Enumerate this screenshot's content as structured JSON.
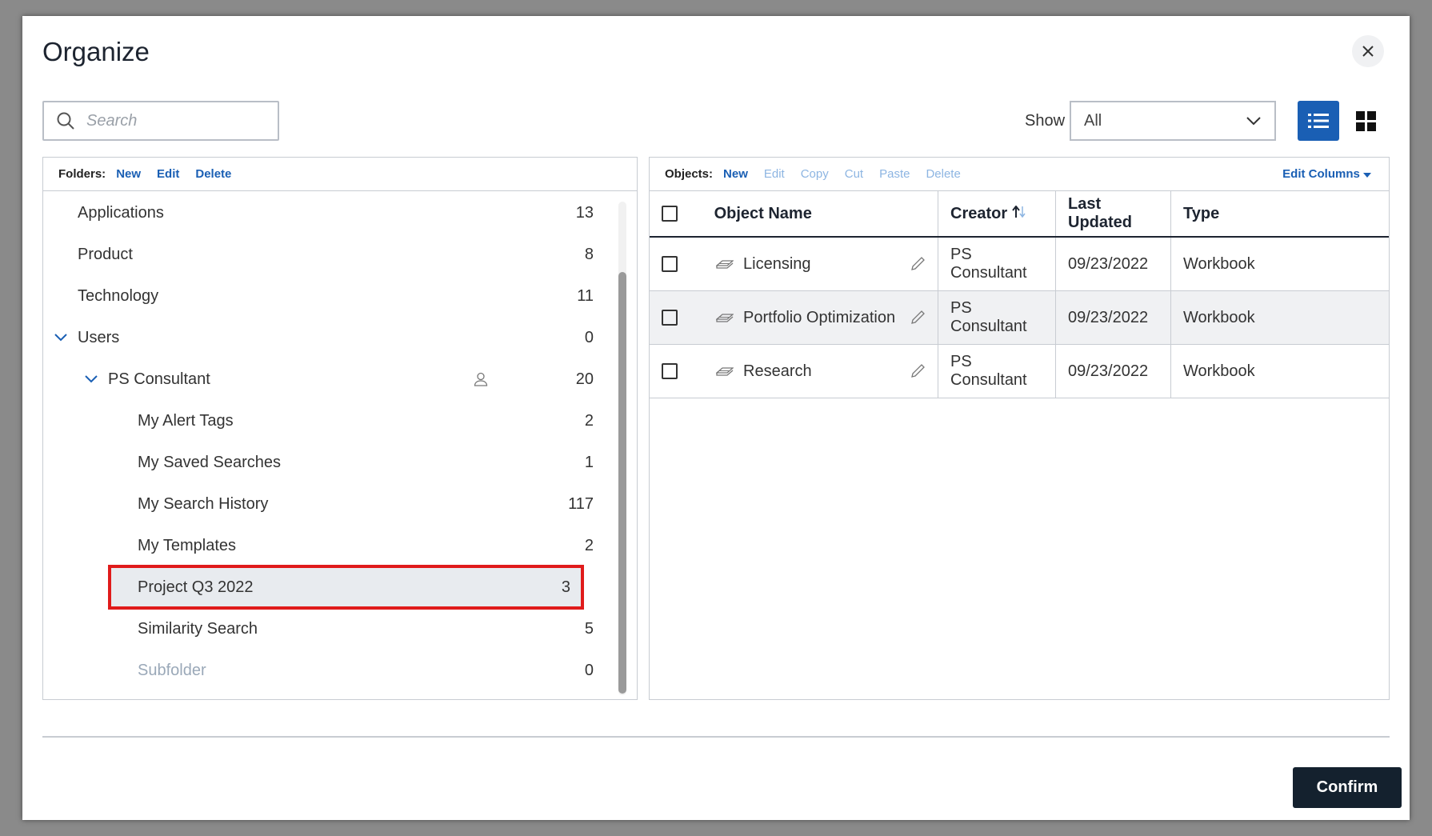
{
  "dialog": {
    "title": "Organize"
  },
  "search": {
    "placeholder": "Search"
  },
  "show": {
    "label": "Show",
    "selected": "All"
  },
  "folders_toolbar": {
    "label": "Folders:",
    "new": "New",
    "edit": "Edit",
    "delete": "Delete"
  },
  "objects_toolbar": {
    "label": "Objects:",
    "new": "New",
    "edit": "Edit",
    "copy": "Copy",
    "cut": "Cut",
    "paste": "Paste",
    "delete": "Delete",
    "edit_columns": "Edit Columns"
  },
  "folders": [
    {
      "name": "Applications",
      "count": "13"
    },
    {
      "name": "Product",
      "count": "8"
    },
    {
      "name": "Technology",
      "count": "11"
    },
    {
      "name": "Users",
      "count": "0"
    },
    {
      "name": "PS Consultant",
      "count": "20"
    },
    {
      "name": "My Alert Tags",
      "count": "2"
    },
    {
      "name": "My Saved Searches",
      "count": "1"
    },
    {
      "name": "My Search History",
      "count": "117"
    },
    {
      "name": "My Templates",
      "count": "2"
    },
    {
      "name": "Project Q3 2022",
      "count": "3"
    },
    {
      "name": "Similarity Search",
      "count": "5"
    },
    {
      "name": "Subfolder",
      "count": "0"
    }
  ],
  "table": {
    "headers": {
      "name": "Object Name",
      "creator": "Creator",
      "updated": "Last Updated",
      "type": "Type"
    },
    "rows": [
      {
        "name": "Licensing",
        "creator": "PS Consultant",
        "updated": "09/23/2022",
        "type": "Workbook"
      },
      {
        "name": "Portfolio Optimization",
        "creator": "PS Consultant",
        "updated": "09/23/2022",
        "type": "Workbook"
      },
      {
        "name": "Research",
        "creator": "PS Consultant",
        "updated": "09/23/2022",
        "type": "Workbook"
      }
    ]
  },
  "footer": {
    "confirm": "Confirm"
  },
  "colors": {
    "accent": "#1a5fb4",
    "highlight": "#e01b1b",
    "confirm_bg": "#14212e"
  }
}
